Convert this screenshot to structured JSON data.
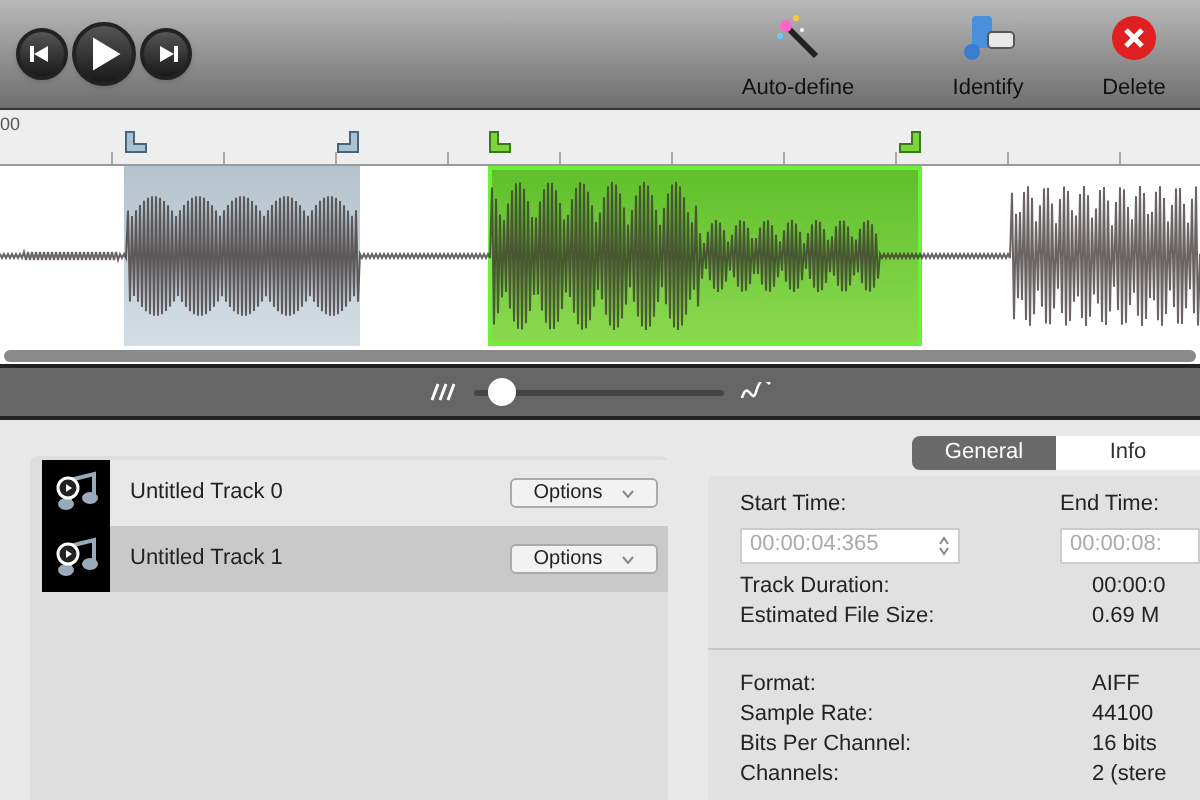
{
  "toolbar": {
    "transport": [
      {
        "kind": "previous"
      },
      {
        "kind": "play"
      },
      {
        "kind": "next"
      }
    ],
    "actions": [
      {
        "kind": "wand",
        "label": "Auto-define"
      },
      {
        "kind": "identify",
        "label": "Identify"
      },
      {
        "kind": "delete",
        "label": "Delete"
      }
    ]
  },
  "ruler": {
    "label": "00"
  },
  "regions": [
    {
      "selected": false
    },
    {
      "selected": true
    }
  ],
  "zoom": {
    "level": 0.07
  },
  "tracks": [
    {
      "name": "Untitled Track 0",
      "button": "Options",
      "selected": false
    },
    {
      "name": "Untitled Track 1",
      "button": "Options",
      "selected": true
    }
  ],
  "tabs": [
    {
      "label": "General",
      "selected": true
    },
    {
      "label": "Info",
      "selected": false
    }
  ],
  "general": {
    "start_label": "Start Time:",
    "start_value": "00:00:04:365",
    "end_label": "End Time:",
    "end_value": "00:00:08:",
    "summary": [
      {
        "label": "Track Duration:",
        "value": "00:00:0"
      },
      {
        "label": "Estimated File Size:",
        "value": "0.69 M"
      }
    ],
    "details": [
      {
        "label": "Format:",
        "value": "AIFF"
      },
      {
        "label": "Sample Rate:",
        "value": "44100"
      },
      {
        "label": "Bits Per Channel:",
        "value": "16 bits"
      },
      {
        "label": "Channels:",
        "value": "2 (stere"
      }
    ]
  }
}
